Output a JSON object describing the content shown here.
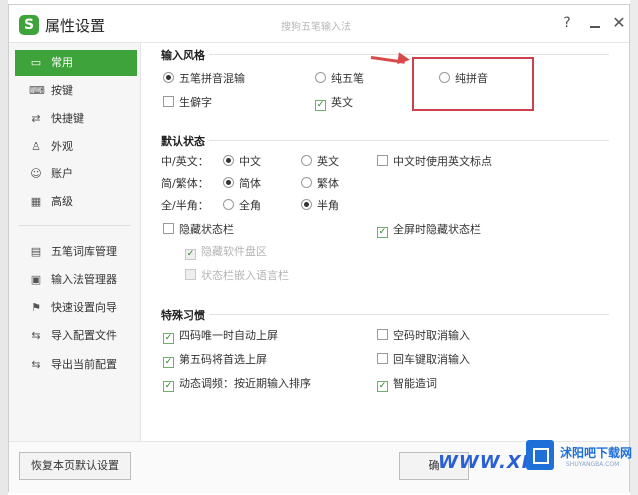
{
  "titlebar": {
    "app_title": "属性设置",
    "subtitle": "搜狗五笔输入法",
    "help": "?",
    "close": "✕"
  },
  "sidebar": {
    "items": [
      {
        "label": "常用",
        "icon": "monitor-icon",
        "glyph": "▭"
      },
      {
        "label": "按键",
        "icon": "keyboard-icon",
        "glyph": "⌨"
      },
      {
        "label": "快捷键",
        "icon": "shortcut-icon",
        "glyph": "⇄"
      },
      {
        "label": "外观",
        "icon": "shirt-icon",
        "glyph": "♙"
      },
      {
        "label": "账户",
        "icon": "user-icon",
        "glyph": "☺"
      },
      {
        "label": "高级",
        "icon": "advanced-icon",
        "glyph": "▦"
      },
      {
        "label": "五笔词库管理",
        "icon": "dictionary-icon",
        "glyph": "▤"
      },
      {
        "label": "输入法管理器",
        "icon": "manager-icon",
        "glyph": "▣"
      },
      {
        "label": "快速设置向导",
        "icon": "flag-icon",
        "glyph": "⚑"
      },
      {
        "label": "导入配置文件",
        "icon": "import-icon",
        "glyph": "⇆"
      },
      {
        "label": "导出当前配置",
        "icon": "export-icon",
        "glyph": "⇆"
      }
    ]
  },
  "sections": {
    "input_style": {
      "title": "输入风格",
      "options": [
        {
          "label": "五笔拼音混输",
          "checked": true
        },
        {
          "label": "纯五笔",
          "checked": false
        },
        {
          "label": "纯拼音",
          "checked": false
        },
        {
          "label": "生僻字",
          "checked": false
        },
        {
          "label": "英文",
          "checked": true
        }
      ]
    },
    "default_state": {
      "title": "默认状态",
      "row_labels": [
        "中/英文：",
        "简/繁体：",
        "全/半角："
      ],
      "options": {
        "zh": "中文",
        "en": "英文",
        "zh_en_punct": "中文时使用英文标点",
        "simplified": "简体",
        "traditional": "繁体",
        "full": "全角",
        "half": "半角",
        "hide_status": "隐藏状态栏",
        "hide_fullscreen": "全屏时隐藏状态栏",
        "hide_soft_kb": "隐藏软件盘区",
        "status_in_lang_bar": "状态栏嵌入语言栏"
      }
    },
    "habits": {
      "title": "特殊习惯",
      "options": [
        {
          "label": "四码唯一时自动上屏",
          "checked": true
        },
        {
          "label": "空码时取消输入",
          "checked": false
        },
        {
          "label": "第五码将首选上屏",
          "checked": true
        },
        {
          "label": "回车键取消输入",
          "checked": false
        },
        {
          "label": "动态调频：按近期输入排序",
          "checked": true
        },
        {
          "label": "智能造词",
          "checked": true
        }
      ]
    }
  },
  "footer": {
    "restore_label": "恢复本页默认设置",
    "ok_label": "确"
  },
  "watermark": {
    "text": "WWW.XF",
    "brand": "沭阳吧下载网",
    "sub": "SHUYANGBA.COM"
  },
  "colors": {
    "accent": "#3fa33b",
    "highlight": "#c9424a",
    "watermark": "#1f6fd8"
  }
}
